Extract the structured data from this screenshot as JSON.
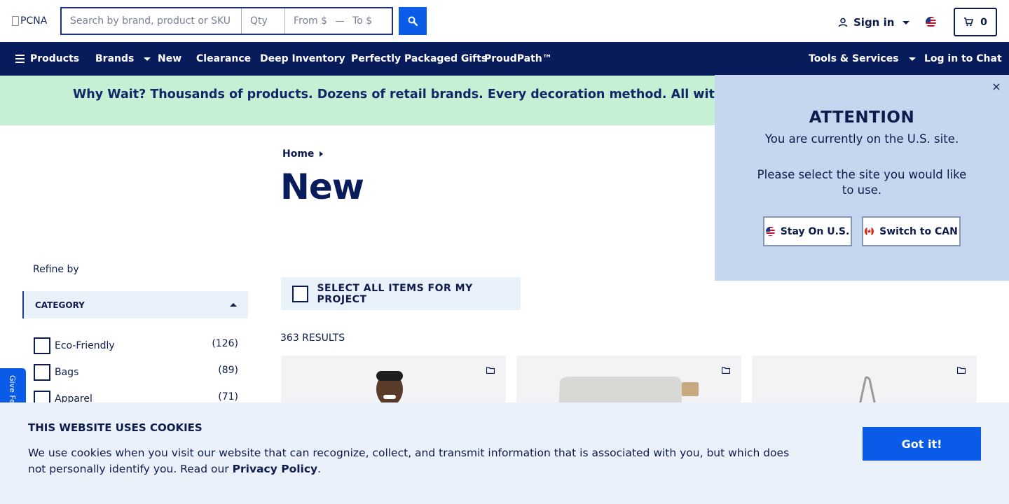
{
  "header": {
    "logo_alt": "PCNA",
    "search_placeholder": "Search by brand, product or SKU",
    "qty_placeholder": "Qty",
    "price_from_placeholder": "From $",
    "price_to_placeholder": "To $",
    "sign_in_label": "Sign in",
    "cart_count": "0"
  },
  "nav": {
    "products": "Products",
    "brands": "Brands",
    "new": "New",
    "clearance": "Clearance",
    "deep_inventory": "Deep Inventory",
    "packaged_gifts": "Perfectly Packaged Gifts",
    "proudpath": "ProudPath™",
    "tools_services": "Tools & Services",
    "chat": "Log in to Chat"
  },
  "promo": {
    "text": "Why Wait? Thousands of products. Dozens of retail brands. Every decoration method. All with a standard"
  },
  "breadcrumb": {
    "home": "Home"
  },
  "page_title": "New",
  "sidebar": {
    "refine_label": "Refine by",
    "category_label": "CATEGORY",
    "categories": [
      {
        "label": "Eco-Friendly",
        "count": "(126)"
      },
      {
        "label": "Bags",
        "count": "(89)"
      },
      {
        "label": "Apparel",
        "count": "(71)"
      }
    ],
    "feedback_label": "Give Fe"
  },
  "main": {
    "select_all_label": "SELECT ALL ITEMS FOR MY PROJECT",
    "results_count": "363 RESULTS"
  },
  "attention": {
    "title": "ATTENTION",
    "line1": "You are currently on the U.S. site.",
    "line2": "Please select the site you would like to use.",
    "stay_label": "Stay On U.S.",
    "switch_label": "Switch to CAN",
    "close_symbol": "×"
  },
  "cookie": {
    "title": "THIS WEBSITE USES COOKIES",
    "body": "We use cookies when you visit our website that can recognize, collect, and transmit information that is associated with you, but which does not personally identify you. Read our",
    "policy_link": "Privacy Policy",
    "period": ".",
    "button_label": "Got it!"
  },
  "colors": {
    "navy": "#081b5b",
    "accent_blue": "#0a5ce8",
    "promo_green": "#c5f0d4",
    "attention_bg": "#c6d6ee",
    "cookie_bg": "#eaf1fb"
  },
  "icons": [
    "broken-image-icon",
    "search-icon",
    "user-icon",
    "us-flag-icon",
    "cart-icon",
    "hamburger-icon",
    "close-icon",
    "ca-flag-icon",
    "folder-icon"
  ]
}
